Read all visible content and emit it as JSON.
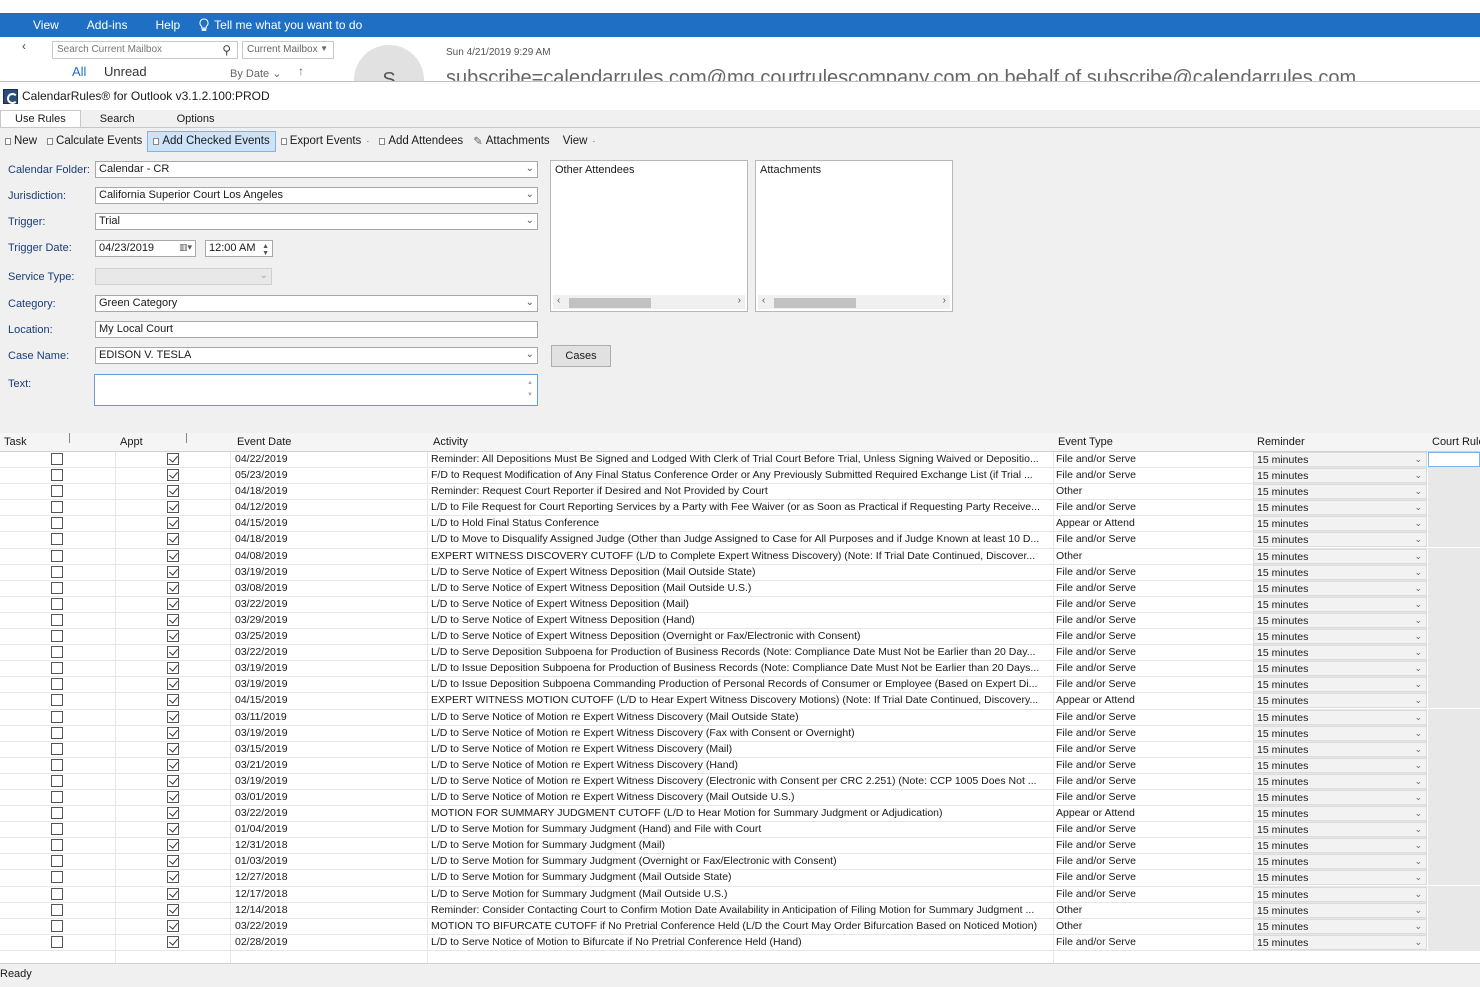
{
  "menubar": {
    "items": [
      "View",
      "Add-ins",
      "Help"
    ],
    "tell_me": "Tell me what you want to do"
  },
  "mail": {
    "search_placeholder": "Search Current Mailbox",
    "scope": "Current Mailbox",
    "filter_all": "All",
    "filter_unread": "Unread",
    "sort": "By Date",
    "avatar_letter": "S",
    "date": "Sun 4/21/2019 9:29 AM",
    "from": "subscribe=calendarrules.com@mg.courtrulescompany.com on behalf of subscribe@calendarrules.com"
  },
  "panel": {
    "title": "CalendarRules® for Outlook v3.1.2.100:PROD",
    "tabs": [
      "Use Rules",
      "Search",
      "Options"
    ],
    "toolbar": {
      "new": "New",
      "calculate": "Calculate Events",
      "add_checked": "Add Checked Events",
      "export": "Export Events",
      "add_attendees": "Add Attendees",
      "attachments": "Attachments",
      "view": "View"
    },
    "form": {
      "calendar_folder_label": "Calendar Folder:",
      "calendar_folder": "Calendar - CR",
      "jurisdiction_label": "Jurisdiction:",
      "jurisdiction": "California Superior Court Los Angeles",
      "trigger_label": "Trigger:",
      "trigger": "Trial",
      "trigger_date_label": "Trigger Date:",
      "trigger_date": "04/23/2019",
      "trigger_time": "12:00 AM",
      "service_type_label": "Service Type:",
      "service_type": "",
      "category_label": "Category:",
      "category": "Green Category",
      "location_label": "Location:",
      "location": "My Local Court",
      "case_name_label": "Case Name:",
      "case_name": "EDISON V. TESLA",
      "text_label": "Text:",
      "text": ""
    },
    "other_attendees_label": "Other Attendees",
    "attachments_label": "Attachments",
    "cases_button": "Cases"
  },
  "grid": {
    "headers": {
      "task": "Task",
      "appt": "Appt",
      "event_date": "Event Date",
      "activity": "Activity",
      "event_type": "Event Type",
      "reminder": "Reminder",
      "court_rule": "Court Rule"
    },
    "rows": [
      {
        "task": false,
        "appt": true,
        "date": "04/22/2019",
        "activity": "Reminder: All Depositions Must Be Signed and Lodged With Clerk of Trial Court Before Trial, Unless Signing Waived or Depositio...",
        "type": "File and/or Serve",
        "reminder": "15 minutes"
      },
      {
        "task": false,
        "appt": true,
        "date": "05/23/2019",
        "activity": "F/D to Request Modification of Any Final Status Conference Order or Any Previously Submitted Required Exchange List (if Trial ...",
        "type": "File and/or Serve",
        "reminder": "15 minutes"
      },
      {
        "task": false,
        "appt": true,
        "date": "04/18/2019",
        "activity": "Reminder: Request Court Reporter if Desired and Not Provided by Court",
        "type": "Other",
        "reminder": "15 minutes"
      },
      {
        "task": false,
        "appt": true,
        "date": "04/12/2019",
        "activity": "L/D to File Request for Court Reporting Services by a Party with Fee Waiver (or as Soon as Practical if Requesting Party Receive...",
        "type": "File and/or Serve",
        "reminder": "15 minutes"
      },
      {
        "task": false,
        "appt": true,
        "date": "04/15/2019",
        "activity": "L/D to Hold Final Status Conference",
        "type": "Appear or Attend",
        "reminder": "15 minutes"
      },
      {
        "task": false,
        "appt": true,
        "date": "04/18/2019",
        "activity": "L/D to Move to Disqualify Assigned Judge (Other than Judge Assigned to Case for All Purposes and if Judge Known at least 10 D...",
        "type": "File and/or Serve",
        "reminder": "15 minutes"
      },
      {
        "task": false,
        "appt": true,
        "date": "04/08/2019",
        "activity": "EXPERT WITNESS DISCOVERY CUTOFF (L/D to Complete Expert Witness Discovery) (Note: If Trial Date Continued, Discover...",
        "type": "Other",
        "reminder": "15 minutes"
      },
      {
        "task": false,
        "appt": true,
        "date": "03/19/2019",
        "activity": "L/D to Serve Notice of Expert Witness Deposition (Mail Outside State)",
        "type": "File and/or Serve",
        "reminder": "15 minutes"
      },
      {
        "task": false,
        "appt": true,
        "date": "03/08/2019",
        "activity": "L/D to Serve Notice of Expert Witness Deposition (Mail Outside U.S.)",
        "type": "File and/or Serve",
        "reminder": "15 minutes"
      },
      {
        "task": false,
        "appt": true,
        "date": "03/22/2019",
        "activity": "L/D to Serve Notice of Expert Witness Deposition (Mail)",
        "type": "File and/or Serve",
        "reminder": "15 minutes"
      },
      {
        "task": false,
        "appt": true,
        "date": "03/29/2019",
        "activity": "L/D to Serve Notice of Expert Witness Deposition (Hand)",
        "type": "File and/or Serve",
        "reminder": "15 minutes"
      },
      {
        "task": false,
        "appt": true,
        "date": "03/25/2019",
        "activity": "L/D to Serve Notice of Expert Witness Deposition (Overnight or Fax/Electronic with Consent)",
        "type": "File and/or Serve",
        "reminder": "15 minutes"
      },
      {
        "task": false,
        "appt": true,
        "date": "03/22/2019",
        "activity": "L/D to Serve Deposition Subpoena for Production of Business Records (Note: Compliance Date Must Not be Earlier than 20 Day...",
        "type": "File and/or Serve",
        "reminder": "15 minutes"
      },
      {
        "task": false,
        "appt": true,
        "date": "03/19/2019",
        "activity": "L/D to Issue Deposition Subpoena for Production of Business Records (Note: Compliance Date Must Not be Earlier than 20 Days...",
        "type": "File and/or Serve",
        "reminder": "15 minutes"
      },
      {
        "task": false,
        "appt": true,
        "date": "03/19/2019",
        "activity": "L/D to Issue Deposition Subpoena Commanding Production of Personal Records of Consumer or Employee (Based on Expert Di...",
        "type": "File and/or Serve",
        "reminder": "15 minutes"
      },
      {
        "task": false,
        "appt": true,
        "date": "04/15/2019",
        "activity": "EXPERT WITNESS MOTION CUTOFF (L/D to Hear Expert Witness Discovery Motions) (Note: If Trial Date Continued, Discovery...",
        "type": "Appear or Attend",
        "reminder": "15 minutes"
      },
      {
        "task": false,
        "appt": true,
        "date": "03/11/2019",
        "activity": "L/D to Serve Notice of Motion re Expert Witness Discovery (Mail Outside State)",
        "type": "File and/or Serve",
        "reminder": "15 minutes"
      },
      {
        "task": false,
        "appt": true,
        "date": "03/19/2019",
        "activity": "L/D to Serve Notice of Motion re Expert Witness Discovery (Fax with Consent or Overnight)",
        "type": "File and/or Serve",
        "reminder": "15 minutes"
      },
      {
        "task": false,
        "appt": true,
        "date": "03/15/2019",
        "activity": "L/D to Serve Notice of Motion re Expert Witness Discovery (Mail)",
        "type": "File and/or Serve",
        "reminder": "15 minutes"
      },
      {
        "task": false,
        "appt": true,
        "date": "03/21/2019",
        "activity": "L/D to Serve Notice of Motion re Expert Witness Discovery (Hand)",
        "type": "File and/or Serve",
        "reminder": "15 minutes"
      },
      {
        "task": false,
        "appt": true,
        "date": "03/19/2019",
        "activity": "L/D to Serve Notice of Motion re Expert Witness Discovery (Electronic with Consent per CRC 2.251) (Note: CCP 1005 Does Not ...",
        "type": "File and/or Serve",
        "reminder": "15 minutes"
      },
      {
        "task": false,
        "appt": true,
        "date": "03/01/2019",
        "activity": "L/D to Serve Notice of Motion re Expert Witness Discovery (Mail Outside U.S.)",
        "type": "File and/or Serve",
        "reminder": "15 minutes"
      },
      {
        "task": false,
        "appt": true,
        "date": "03/22/2019",
        "activity": "MOTION FOR SUMMARY JUDGMENT CUTOFF (L/D to Hear Motion for Summary Judgment or Adjudication)",
        "type": "Appear or Attend",
        "reminder": "15 minutes"
      },
      {
        "task": false,
        "appt": true,
        "date": "01/04/2019",
        "activity": "L/D to Serve Motion for Summary Judgment (Hand) and File with Court",
        "type": "File and/or Serve",
        "reminder": "15 minutes"
      },
      {
        "task": false,
        "appt": true,
        "date": "12/31/2018",
        "activity": "L/D to Serve Motion for Summary Judgment (Mail)",
        "type": "File and/or Serve",
        "reminder": "15 minutes"
      },
      {
        "task": false,
        "appt": true,
        "date": "01/03/2019",
        "activity": "L/D to Serve Motion for Summary Judgment (Overnight or Fax/Electronic with Consent)",
        "type": "File and/or Serve",
        "reminder": "15 minutes"
      },
      {
        "task": false,
        "appt": true,
        "date": "12/27/2018",
        "activity": "L/D to Serve Motion for Summary Judgment (Mail Outside State)",
        "type": "File and/or Serve",
        "reminder": "15 minutes"
      },
      {
        "task": false,
        "appt": true,
        "date": "12/17/2018",
        "activity": "L/D to Serve Motion for Summary Judgment (Mail Outside U.S.)",
        "type": "File and/or Serve",
        "reminder": "15 minutes"
      },
      {
        "task": false,
        "appt": true,
        "date": "12/14/2018",
        "activity": "Reminder: Consider Contacting Court to Confirm Motion Date Availability in Anticipation of Filing Motion for Summary Judgment ...",
        "type": "Other",
        "reminder": "15 minutes"
      },
      {
        "task": false,
        "appt": true,
        "date": "03/22/2019",
        "activity": "MOTION TO BIFURCATE CUTOFF if No Pretrial Conference Held (L/D the Court May Order Bifurcation Based on Noticed Motion)",
        "type": "Other",
        "reminder": "15 minutes"
      },
      {
        "task": false,
        "appt": true,
        "date": "02/28/2019",
        "activity": "L/D to Serve Notice of Motion to Bifurcate if No Pretrial Conference Held (Hand)",
        "type": "File and/or Serve",
        "reminder": "15 minutes"
      }
    ]
  },
  "status": "Ready"
}
